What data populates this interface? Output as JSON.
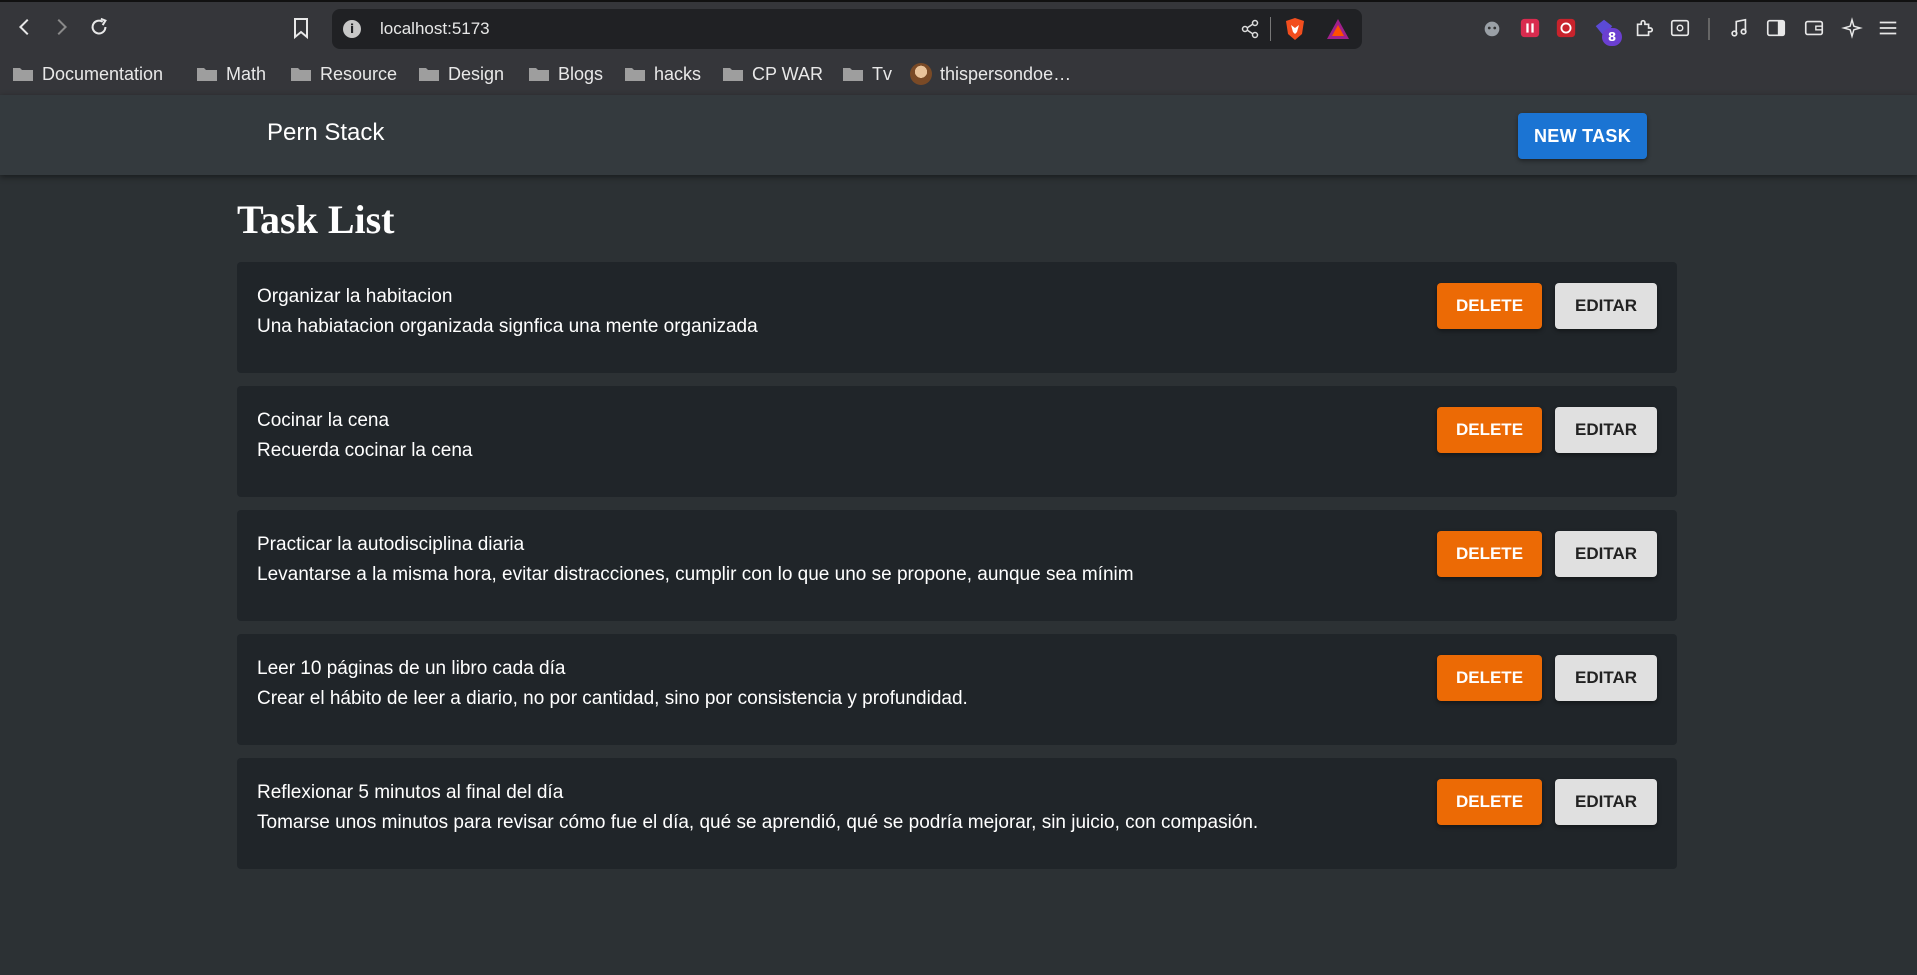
{
  "browser": {
    "url": "localhost:5173",
    "extension_badge": "8",
    "bookmarks": [
      {
        "label": "Documentation",
        "icon": "folder-icon"
      },
      {
        "label": "Math",
        "icon": "folder-icon"
      },
      {
        "label": "Resource",
        "icon": "folder-icon"
      },
      {
        "label": "Design",
        "icon": "folder-icon"
      },
      {
        "label": "Blogs",
        "icon": "folder-icon"
      },
      {
        "label": "hacks",
        "icon": "folder-icon"
      },
      {
        "label": "CP WAR",
        "icon": "folder-icon"
      },
      {
        "label": "Tv",
        "icon": "folder-icon"
      },
      {
        "label": "thispersondoe…",
        "icon": "avatar-icon"
      }
    ]
  },
  "app": {
    "title": "Pern Stack",
    "new_task_label": "NEW TASK",
    "heading": "Task List",
    "delete_label": "DELETE",
    "edit_label": "EDITAR",
    "colors": {
      "primary": "#1b74d3",
      "delete": "#ec6a05",
      "card": "#202529",
      "background": "#2c3134"
    },
    "tasks": [
      {
        "title": "Organizar la habitacion",
        "description": "Una habiatacion organizada signfica una mente organizada"
      },
      {
        "title": "Cocinar la cena",
        "description": "Recuerda cocinar la cena"
      },
      {
        "title": "Practicar la autodisciplina diaria",
        "description": "Levantarse a la misma hora, evitar distracciones, cumplir con lo que uno se propone, aunque sea mínim"
      },
      {
        "title": "Leer 10 páginas de un libro cada día",
        "description": "Crear el hábito de leer a diario, no por cantidad, sino por consistencia y profundidad."
      },
      {
        "title": "Reflexionar 5 minutos al final del día",
        "description": "Tomarse unos minutos para revisar cómo fue el día, qué se aprendió, qué se podría mejorar, sin juicio, con compasión."
      }
    ]
  }
}
